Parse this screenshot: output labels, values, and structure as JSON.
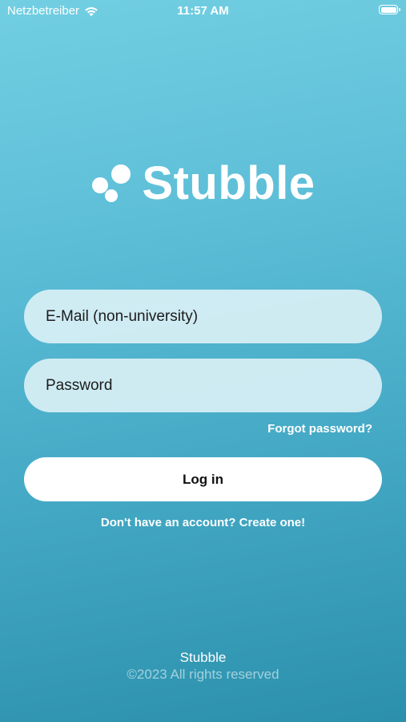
{
  "status_bar": {
    "carrier": "Netzbetreiber",
    "time": "11:57 AM"
  },
  "brand": {
    "name": "Stubble",
    "icon": "bubbles-logo-icon"
  },
  "login_form": {
    "email_placeholder": "E-Mail (non-university)",
    "email_value": "",
    "password_placeholder": "Password",
    "password_value": "",
    "forgot_password_label": "Forgot password?",
    "login_label": "Log in",
    "signup_label": "Don't have an account? Create one!"
  },
  "footer": {
    "brand": "Stubble",
    "copyright": "©2023 All rights reserved"
  },
  "colors": {
    "gradient_top": "#72cfe2",
    "gradient_bottom": "#2b90ac",
    "field_background": "#e0f2f7",
    "button_background": "#ffffff"
  }
}
